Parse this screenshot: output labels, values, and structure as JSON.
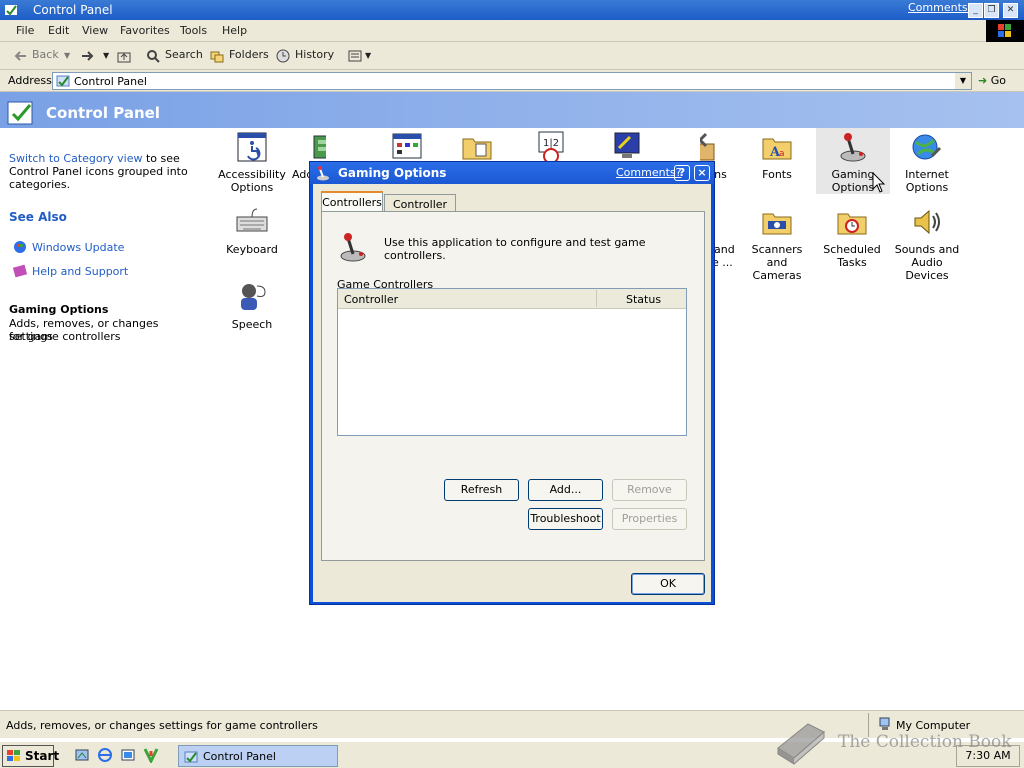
{
  "window": {
    "title": "Control Panel",
    "comments_link": "Comments?"
  },
  "menu": {
    "items": [
      "File",
      "Edit",
      "View",
      "Favorites",
      "Tools",
      "Help"
    ]
  },
  "toolbar": {
    "back": "Back",
    "search": "Search",
    "folders": "Folders",
    "history": "History"
  },
  "address": {
    "label": "Address",
    "value": "Control Panel",
    "go": "Go"
  },
  "header": {
    "title": "Control Panel"
  },
  "left_pane": {
    "switch_link": "Switch to Category view",
    "switch_text_1": " to see",
    "switch_text_2": "Control Panel icons grouped into",
    "switch_text_3": "categories.",
    "see_also": "See Also",
    "links": [
      "Windows Update",
      "Help and Support"
    ],
    "details_title": "Gaming Options",
    "details_text_1": "Adds, removes, or changes settings",
    "details_text_2": "for game controllers"
  },
  "icons": [
    {
      "line1": "Accessibility",
      "line2": "Options",
      "icon": "accessibility-icon"
    },
    {
      "line1": "Add",
      "line2": "",
      "icon": "add-hardware-icon"
    },
    {
      "line1": "tions",
      "line2": "",
      "icon": "admin-tools-icon"
    },
    {
      "line1": "Fonts",
      "line2": "",
      "icon": "fonts-icon"
    },
    {
      "line1": "Gaming",
      "line2": "Options",
      "icon": "joystick-icon"
    },
    {
      "line1": "Internet",
      "line2": "Options",
      "icon": "internet-options-icon"
    },
    {
      "line1": "Keyboard",
      "line2": "",
      "icon": "keyboard-icon"
    },
    {
      "line1": "and",
      "line2": "e ...",
      "icon": "phone-modem-icon"
    },
    {
      "line1": "Scanners and",
      "line2": "Cameras",
      "icon": "scanner-icon"
    },
    {
      "line1": "Scheduled",
      "line2": "Tasks",
      "icon": "scheduled-tasks-icon"
    },
    {
      "line1": "Sounds and",
      "line2": "Audio Devices",
      "icon": "speaker-icon"
    },
    {
      "line1": "Speech",
      "line2": "",
      "icon": "speech-icon"
    }
  ],
  "status": {
    "text": "Adds, removes, or changes settings for game controllers",
    "zone": "My Computer"
  },
  "taskbar": {
    "start": "Start",
    "task": "Control Panel",
    "clock": "7:30 AM"
  },
  "watermark": "The Collection Book",
  "dialog": {
    "title": "Gaming Options",
    "comments": "Comments?",
    "help": "?",
    "close": "×",
    "tabs": [
      "Controllers",
      "Controller IDs"
    ],
    "info": "Use this application to configure and test game controllers.",
    "group_label": "Game Controllers",
    "columns": [
      "Controller",
      "Status"
    ],
    "buttons": {
      "refresh": "Refresh",
      "add": "Add...",
      "remove": "Remove",
      "troubleshoot": "Troubleshoot",
      "properties": "Properties",
      "ok": "OK"
    }
  },
  "colors": {
    "titlebar": "#1d5cc7",
    "header": "#7aa1e6",
    "link": "#215dc6",
    "dialog_frame": "#0a4fd6"
  }
}
